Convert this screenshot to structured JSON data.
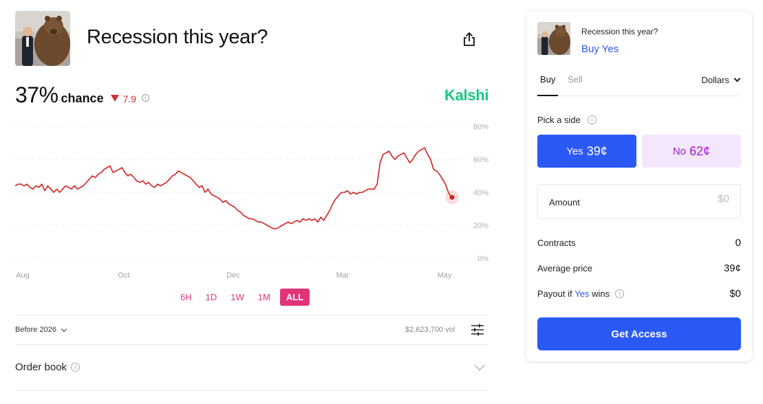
{
  "market": {
    "title": "Recession this year?",
    "image": "bear-statue-photo"
  },
  "share": {
    "icon": "share-icon"
  },
  "probability": {
    "value": "37%",
    "label": "chance",
    "change": "7.9",
    "change_direction": "down",
    "change_color": "#d32f2f",
    "info_icon": "info-icon"
  },
  "brand": {
    "name": "Kalshi",
    "color": "#16c784"
  },
  "chart_data": {
    "type": "line",
    "title": "",
    "xlabel": "",
    "ylabel": "",
    "x_ticks": [
      "Aug",
      "Oct",
      "Dec",
      "Mar",
      "May"
    ],
    "y_ticks": [
      "80%",
      "60%",
      "40%",
      "20%",
      "0%"
    ],
    "ylim": [
      0,
      80
    ],
    "grid": true,
    "line_color": "#d42020",
    "series": [
      {
        "values": [
          44,
          45,
          45,
          44,
          45,
          43,
          42,
          44,
          43,
          45,
          41,
          44,
          42,
          40,
          42,
          40,
          42,
          44,
          43,
          42,
          44,
          42,
          43,
          44,
          46,
          48,
          50,
          49,
          51,
          52,
          54,
          55,
          56,
          52,
          53,
          54,
          55,
          52,
          50,
          51,
          49,
          47,
          46,
          47,
          45,
          46,
          44,
          43,
          45,
          44,
          45,
          46,
          48,
          50,
          51,
          53,
          52,
          51,
          50,
          49,
          47,
          45,
          43,
          44,
          40,
          42,
          39,
          38,
          37,
          36,
          34,
          35,
          33,
          32,
          31,
          29,
          28,
          26,
          25,
          24,
          24,
          23,
          22,
          22,
          21,
          20,
          19,
          18,
          18,
          19,
          20,
          21,
          22,
          21,
          22,
          23,
          22,
          24,
          23,
          24,
          23,
          24,
          22,
          25,
          23,
          26,
          29,
          33,
          36,
          38,
          40,
          40,
          41,
          39,
          40,
          39,
          40,
          40,
          41,
          42,
          42,
          42,
          45,
          58,
          63,
          64,
          65,
          62,
          60,
          62,
          63,
          64,
          61,
          58,
          60,
          63,
          65,
          66,
          67,
          63,
          60,
          54,
          53,
          51,
          48,
          45,
          40,
          37
        ]
      }
    ],
    "current_value": 37
  },
  "time_ranges": {
    "options": [
      "6H",
      "1D",
      "1W",
      "1M",
      "ALL"
    ],
    "selected": "ALL"
  },
  "period": {
    "selected": "Before 2026"
  },
  "volume": "$2,623,700 vol",
  "order_book": {
    "label": "Order book"
  },
  "trade_panel": {
    "market_title": "Recession this year?",
    "side_label": "Buy Yes",
    "tabs": [
      "Buy",
      "Sell"
    ],
    "active_tab": "Buy",
    "currency": "Dollars",
    "pick_side_label": "Pick a side",
    "yes": {
      "label": "Yes",
      "price": "39¢",
      "color": "#2b59f6"
    },
    "no": {
      "label": "No",
      "price": "62¢",
      "color": "#a21ad4"
    },
    "amount": {
      "label": "Amount",
      "placeholder": "$0",
      "value": ""
    },
    "contracts": {
      "label": "Contracts",
      "value": "0"
    },
    "average_price": {
      "label": "Average price",
      "value": "39¢"
    },
    "payout": {
      "prefix": "Payout if",
      "side": "Yes",
      "suffix": "wins",
      "value": "$0"
    },
    "cta": "Get Access"
  }
}
